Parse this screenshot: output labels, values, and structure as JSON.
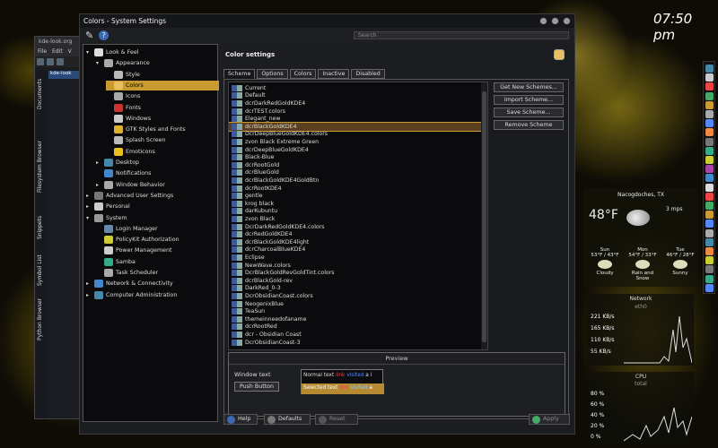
{
  "clock": "07:50 pm",
  "back_window": {
    "title": "kde-look.org",
    "menu": [
      "File",
      "Edit",
      "V"
    ],
    "address": "kde-look",
    "tabs": [
      "Documents",
      "Filesystem Browser",
      "Snippets",
      "Symbol List",
      "Python Browser"
    ]
  },
  "window": {
    "title": "Colors - System Settings",
    "search_placeholder": "Search"
  },
  "tree": [
    {
      "label": "Look & Feel",
      "exp": "▾",
      "color": "#ddd"
    },
    {
      "label": "Appearance",
      "exp": "▾",
      "color": "#aaa"
    },
    {
      "label": "Style",
      "exp": "",
      "color": "#bbb"
    },
    {
      "label": "Colors",
      "exp": "",
      "color": "#e8c060",
      "selected": true
    },
    {
      "label": "Icons",
      "exp": "",
      "color": "#aaa"
    },
    {
      "label": "Fonts",
      "exp": "",
      "color": "#c33"
    },
    {
      "label": "Windows",
      "exp": "",
      "color": "#ccc"
    },
    {
      "label": "GTK Styles and Fonts",
      "exp": "",
      "color": "#ddb030"
    },
    {
      "label": "Splash Screen",
      "exp": "",
      "color": "#bbb"
    },
    {
      "label": "Emoticons",
      "exp": "",
      "color": "#e8c020"
    },
    {
      "label": "Desktop",
      "exp": "▸",
      "color": "#48a"
    },
    {
      "label": "Notifications",
      "exp": "",
      "color": "#48c"
    },
    {
      "label": "Window Behavior",
      "exp": "▸",
      "color": "#aaa"
    },
    {
      "label": "Advanced User Settings",
      "exp": "▸",
      "color": "#777"
    },
    {
      "label": "Personal",
      "exp": "▸",
      "color": "#ccc"
    },
    {
      "label": "System",
      "exp": "▾",
      "color": "#999"
    },
    {
      "label": "Login Manager",
      "exp": "",
      "color": "#68a"
    },
    {
      "label": "PolicyKit Authorization",
      "exp": "",
      "color": "#cc3"
    },
    {
      "label": "Power Management",
      "exp": "",
      "color": "#ccc"
    },
    {
      "label": "Samba",
      "exp": "",
      "color": "#3a8"
    },
    {
      "label": "Task Scheduler",
      "exp": "",
      "color": "#aaa"
    },
    {
      "label": "Network & Connectivity",
      "exp": "▸",
      "color": "#48c"
    },
    {
      "label": "Computer Administration",
      "exp": "▸",
      "color": "#48a"
    }
  ],
  "pane": {
    "header": "Color settings",
    "tabs": [
      "Scheme",
      "Options",
      "Colors",
      "Inactive",
      "Disabled"
    ]
  },
  "schemes": [
    "Current",
    "Default",
    "dcrDarkRedGoldKDE4",
    "dcrTEST.colors",
    "Elegant_new",
    "dcrBlackGoldKDE4",
    "DcrDeepBlueGoldKDE4.colors",
    "zvon Black Extreme Green",
    "dcrDeepBlueGoldKDE4",
    "Black-Blue",
    "dcrRootGold",
    "dcrBlueGold",
    "dcrBlackGoldKDE4GoldBtn",
    "dcrRootKDE4",
    "gentle",
    "krog black",
    "darKubuntu",
    "zvon Black",
    "DcrDarkRedGoldKDE4.colors",
    "dcrRedGoldKDE4",
    "dcrBlackGoldKDE4light",
    "dcrCharcoalBlueKDE4",
    "Eclipse",
    "NewWave.colors",
    "DcrBlackGoldRevGoldTint.colors",
    "dcrBlackGold-rev",
    "DarkRed_0-3",
    "DcrObsidianCoast.colors",
    "NeogenixBlue",
    "TeaSun",
    "themeinneedofaname",
    "dcrRootRed",
    "dcr - Obsidian Coast",
    "DcrObsidianCoast-3"
  ],
  "selected_scheme": "dcrBlackGoldKDE4",
  "buttons": {
    "get_new": "Get New Schemes...",
    "import": "Import Scheme...",
    "save": "Save Scheme...",
    "remove": "Remove Scheme"
  },
  "preview": {
    "title": "Preview",
    "window_text": "Window text",
    "push_button": "Push Button",
    "normal_text": "Normal text",
    "link": "link",
    "visited": "visited",
    "a": "a",
    "i": "i",
    "selected_text": "Selected text"
  },
  "bottom": {
    "help": "Help",
    "defaults": "Defaults",
    "reset": "Reset",
    "apply": "Apply"
  },
  "weather": {
    "location": "Nacogdoches, TX",
    "temp": "48°F",
    "wind": "3 mps",
    "days": [
      {
        "name": "Sun",
        "range": "53°F / 43°F",
        "cond": "Cloudy"
      },
      {
        "name": "Mon",
        "range": "54°F / 33°F",
        "cond": "Rain and Snow"
      },
      {
        "name": "Tue",
        "range": "46°F / 28°F",
        "cond": "Sunny"
      }
    ]
  },
  "network": {
    "title": "Network",
    "iface": "eth0",
    "labels": [
      "221 KB/s",
      "165 KB/s",
      "110 KB/s",
      "55 KB/s"
    ]
  },
  "cpu": {
    "title": "CPU",
    "sub": "total",
    "labels": [
      "80 %",
      "60 %",
      "40 %",
      "20 %",
      "0 %"
    ]
  }
}
